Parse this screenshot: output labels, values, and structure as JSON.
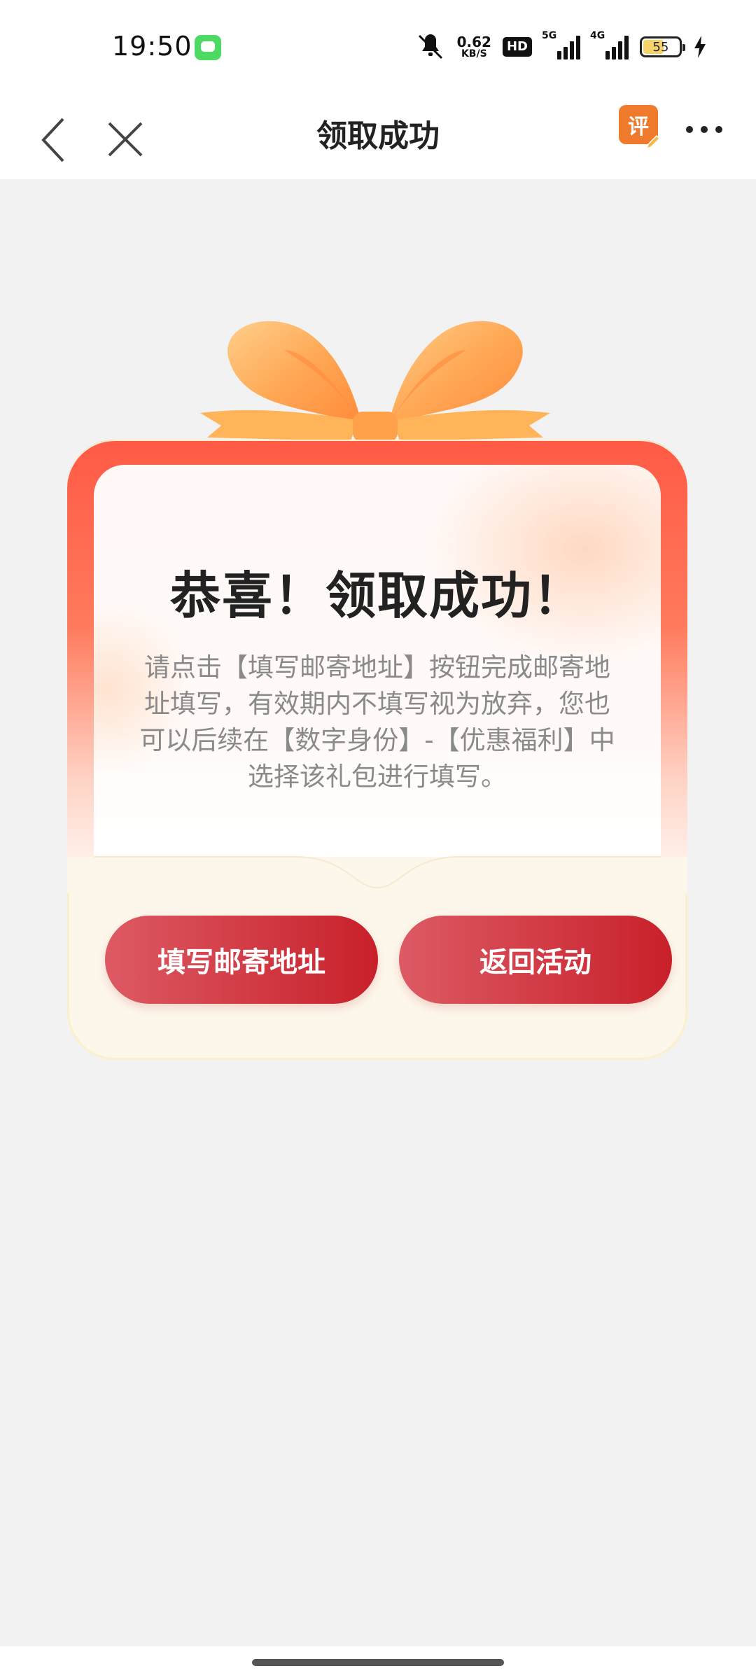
{
  "status_bar": {
    "time": "19:50",
    "net_speed_value": "0.62",
    "net_speed_unit": "KB/S",
    "hd_label": "HD",
    "signal_1_label": "5G",
    "signal_2_label": "4G",
    "battery_level": "55",
    "icons": [
      "message-icon",
      "mute-icon",
      "signal-5g-icon",
      "signal-4g-icon",
      "battery-icon",
      "charging-icon"
    ]
  },
  "nav": {
    "title": "领取成功",
    "review_label": "评",
    "icons": [
      "back-arrow-icon",
      "close-icon",
      "review-icon",
      "more-icon"
    ]
  },
  "card": {
    "headline": "恭喜！领取成功！",
    "description": "请点击【填写邮寄地址】按钮完成邮寄地址填写，有效期内不填写视为放弃，您也可以后续在【数字身份】-【优惠福利】中选择该礼包进行填写。",
    "fill_address_button": "填写邮寄地址",
    "back_button": "返回活动",
    "colors": {
      "button_start": "#dd5a64",
      "button_end": "#c8202a",
      "card_red": "#ff5a45",
      "bow_orange": "#ffb05a"
    }
  }
}
